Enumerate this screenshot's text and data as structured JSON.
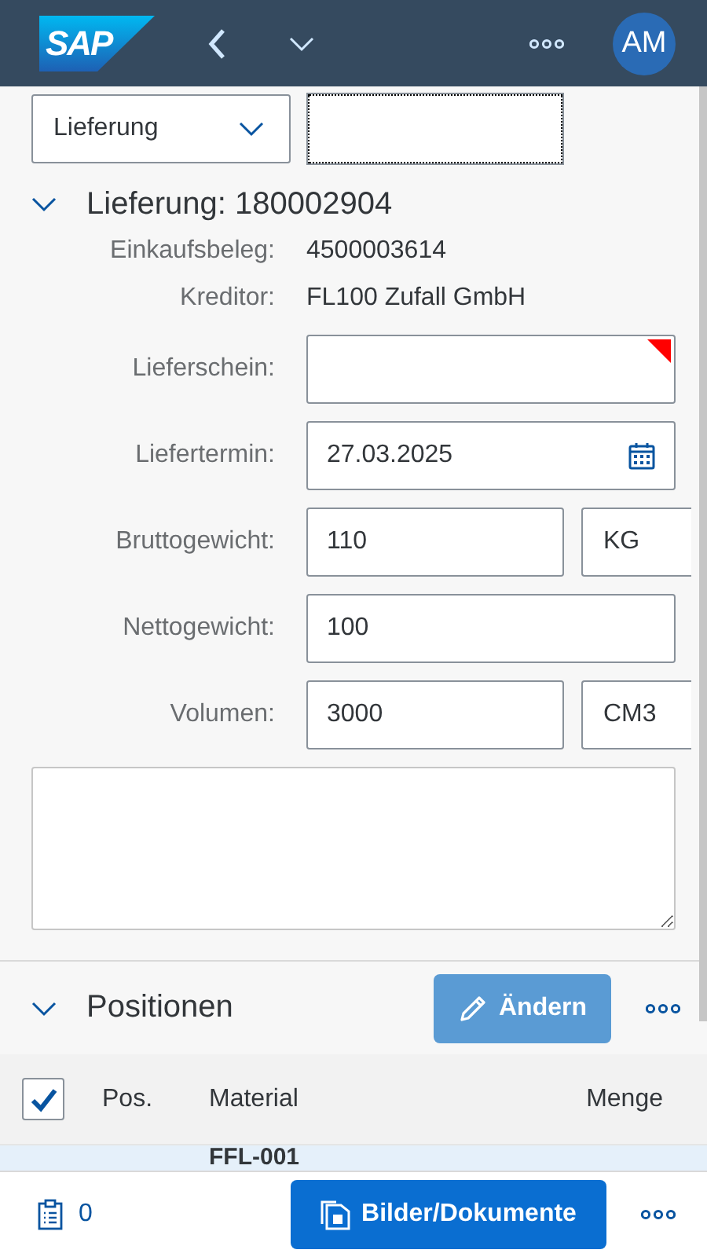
{
  "header": {
    "logo": "SAP",
    "avatar": "AM"
  },
  "selector": {
    "value": "Lieferung"
  },
  "section": {
    "title": "Lieferung: 180002904",
    "expanded": true,
    "fields": [
      {
        "kind": "display",
        "label": "Einkaufsbeleg:",
        "value": "4500003614"
      },
      {
        "kind": "display",
        "label": "Kreditor:",
        "value": "FL100 Zufall GmbH"
      },
      {
        "kind": "input",
        "label": "Lieferschein:",
        "required": true
      },
      {
        "kind": "date",
        "label": "Liefertermin:",
        "value": "27.03.2025",
        "required": false
      },
      {
        "kind": "input_unit",
        "label": "Bruttogewicht:",
        "value": "110",
        "unit": "KG",
        "required": false
      },
      {
        "kind": "input",
        "label": "Nettogewicht:",
        "value": "100",
        "required": false
      },
      {
        "kind": "input_unit",
        "label": "Volumen:",
        "value": "3000",
        "unit": "CM3",
        "required": false
      }
    ]
  },
  "positions": {
    "title": "Positionen",
    "expanded": true,
    "edit_button": {
      "label": "Ändern",
      "disabled": true
    },
    "select_all": true,
    "columns": [
      "Pos.",
      "Material",
      "Menge"
    ],
    "rows": [
      {
        "material": "FFL-001",
        "selected": true
      }
    ]
  },
  "footer": {
    "count": "0",
    "button": "Bilder/Dokumente"
  }
}
